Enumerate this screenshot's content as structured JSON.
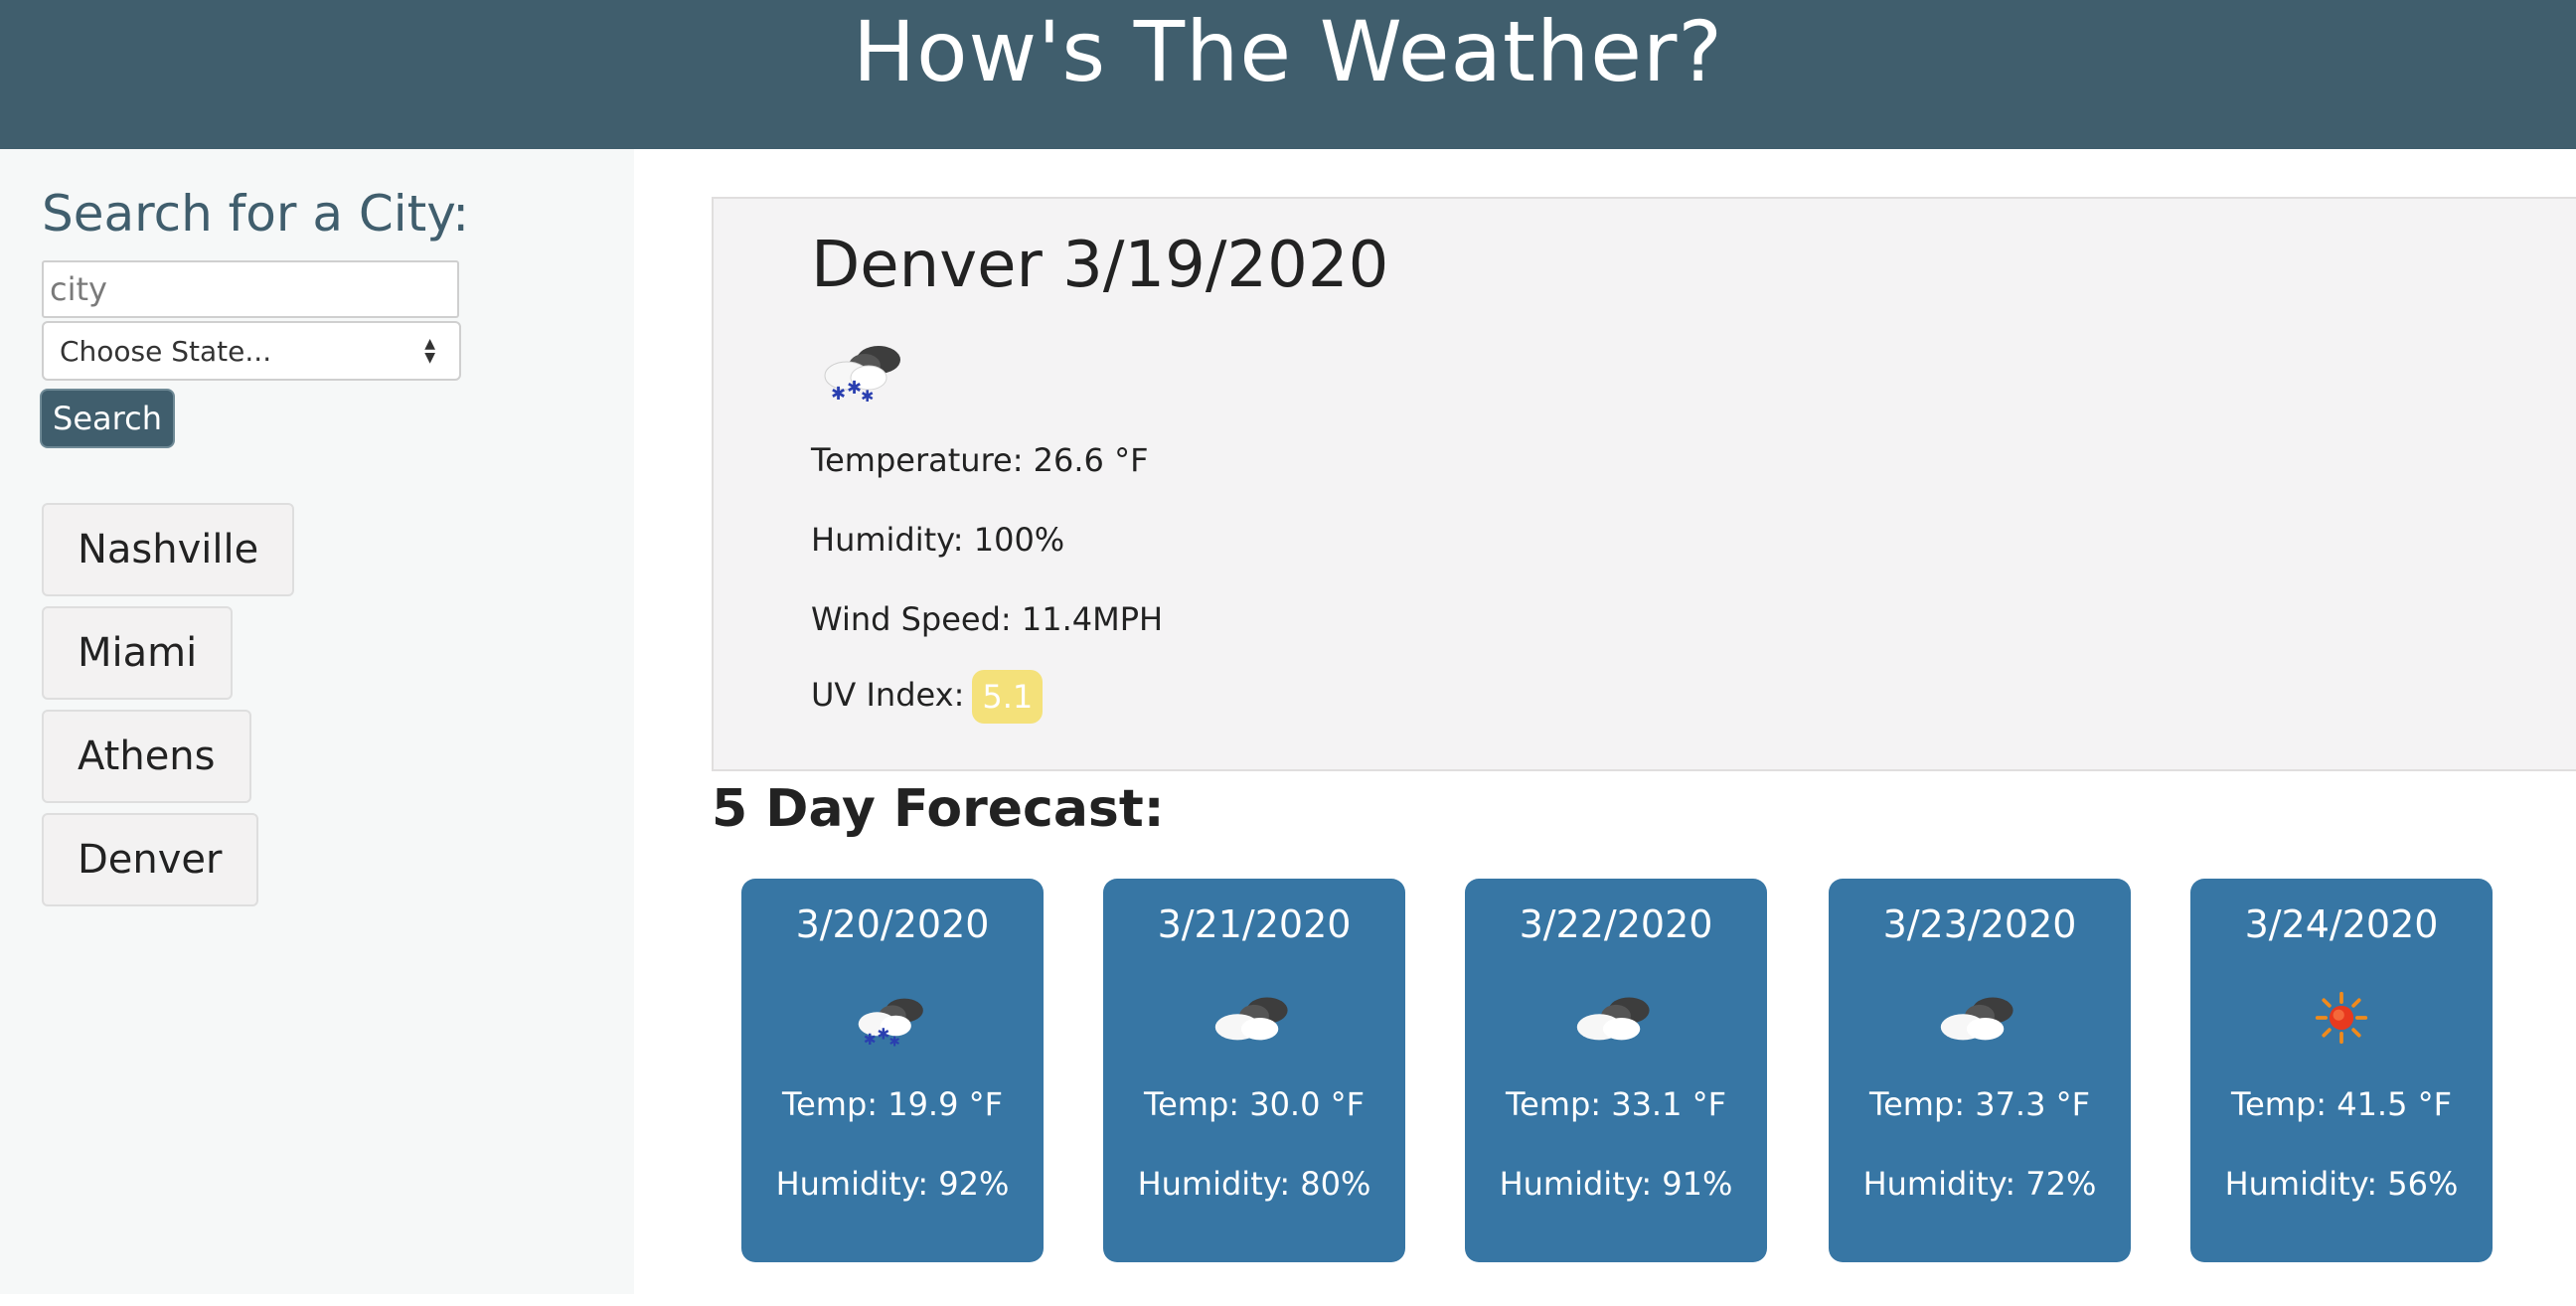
{
  "header": {
    "title": "How's The Weather?"
  },
  "sidebar": {
    "title": "Search for a City:",
    "city_placeholder": "city",
    "state_selected": "Choose State...",
    "search_label": "Search",
    "history": [
      "Nashville",
      "Miami",
      "Athens",
      "Denver"
    ]
  },
  "current": {
    "city_date": "Denver 3/19/2020",
    "icon": "snow-cloud-icon",
    "temperature": "Temperature: 26.6 °F",
    "humidity": "Humidity: 100%",
    "wind": "Wind Speed: 11.4MPH",
    "uv_label": "UV Index:",
    "uv_value": "5.1",
    "uv_color": "#f4e17a"
  },
  "forecast": {
    "title": "5 Day Forecast:",
    "days": [
      {
        "date": "3/20/2020",
        "icon": "snow-cloud-icon",
        "temp": "Temp: 19.9 °F",
        "humidity": "Humidity: 92%"
      },
      {
        "date": "3/21/2020",
        "icon": "cloud-icon",
        "temp": "Temp: 30.0 °F",
        "humidity": "Humidity: 80%"
      },
      {
        "date": "3/22/2020",
        "icon": "cloud-icon",
        "temp": "Temp: 33.1 °F",
        "humidity": "Humidity: 91%"
      },
      {
        "date": "3/23/2020",
        "icon": "cloud-icon",
        "temp": "Temp: 37.3 °F",
        "humidity": "Humidity: 72%"
      },
      {
        "date": "3/24/2020",
        "icon": "sun-icon",
        "temp": "Temp: 41.5 °F",
        "humidity": "Humidity: 56%"
      }
    ]
  },
  "colors": {
    "header": "#405e6d",
    "card": "#3776a4",
    "uv_badge": "#f4e17a"
  }
}
